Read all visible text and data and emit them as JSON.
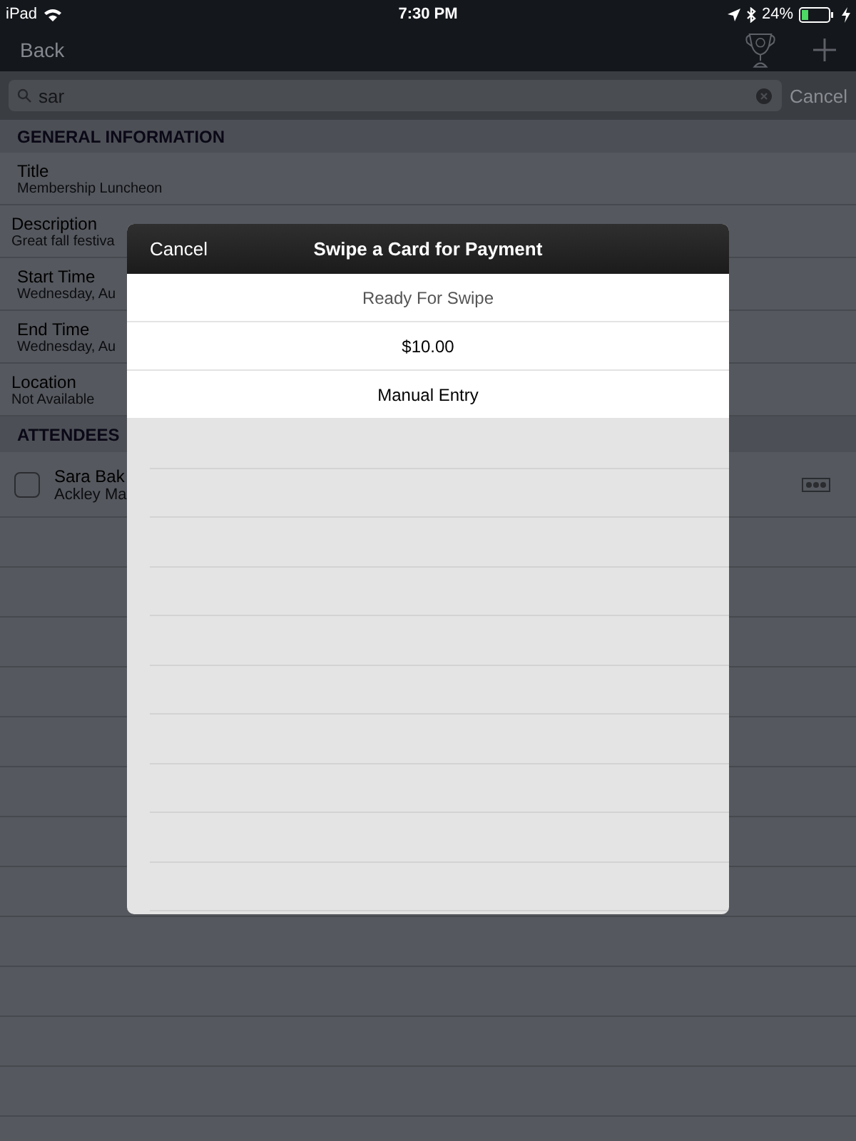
{
  "status_bar": {
    "device": "iPad",
    "time": "7:30 PM",
    "battery": "24%"
  },
  "nav_bar": {
    "back": "Back"
  },
  "search": {
    "value": "sar",
    "cancel": "Cancel"
  },
  "general": {
    "header": "GENERAL INFORMATION",
    "fields": [
      {
        "label": "Title",
        "value": "Membership Luncheon",
        "kind": "inset"
      },
      {
        "label": "Description",
        "value": "Great fall festiva",
        "kind": "plain"
      },
      {
        "label": "Start Time",
        "value": "Wednesday, Au",
        "kind": "inset"
      },
      {
        "label": "End Time",
        "value": "Wednesday, Au",
        "kind": "inset"
      },
      {
        "label": "Location",
        "value": "Not Available",
        "kind": "plain"
      }
    ]
  },
  "attendees": {
    "header": "ATTENDEES",
    "rows": [
      {
        "name": "Sara Bak",
        "org": "Ackley Ma",
        "checked": false
      }
    ]
  },
  "modal": {
    "cancel": "Cancel",
    "title": "Swipe a Card for Payment",
    "rows": [
      {
        "text": "Ready For Swipe",
        "kind": "status"
      },
      {
        "text": "$10.00",
        "kind": "amount"
      },
      {
        "text": "Manual Entry",
        "kind": "action"
      }
    ]
  }
}
